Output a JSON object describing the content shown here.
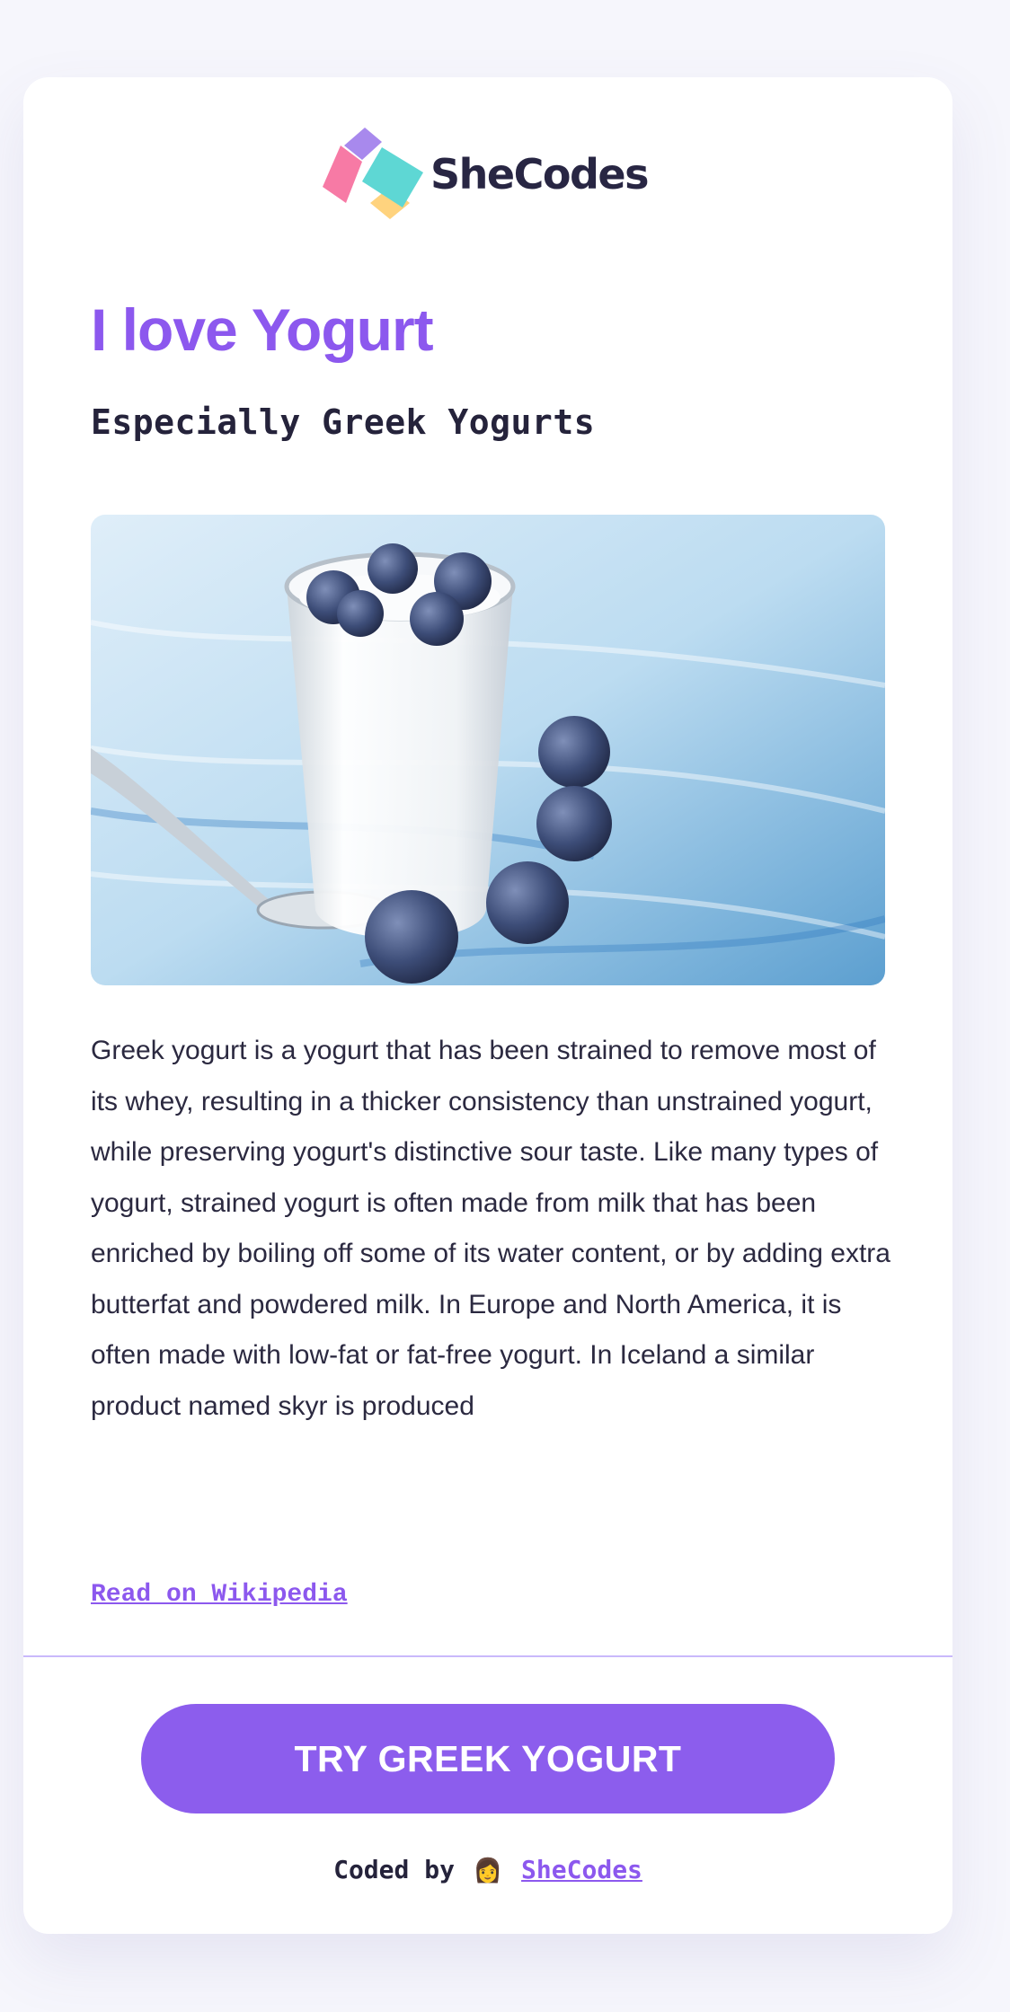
{
  "brand": {
    "name": "SheCodes",
    "colors": {
      "accent": "#8c58ee",
      "button": "#8c5ded",
      "divider": "#c9b9fb",
      "logo_purple": "#a889ed",
      "logo_pink": "#f77aa5",
      "logo_teal": "#5ed7d4",
      "logo_yellow": "#ffd37e"
    }
  },
  "header": {
    "title": "I love Yogurt",
    "subtitle": "Especially Greek Yogurts"
  },
  "image": {
    "subject": "glass-of-yogurt-with-blueberries"
  },
  "description": "Greek yogurt is a yogurt that has been strained to remove most of its whey, resulting in a thicker consistency than unstrained yogurt, while preserving yogurt's distinctive sour taste. Like many types of yogurt, strained yogurt is often made from milk that has been enriched by boiling off some of its water content, or by adding extra butterfat and powdered milk. In Europe and North America, it is often made with low-fat or fat-free yogurt. In Iceland a similar product named skyr is produced",
  "wiki_link": "Read on Wikipedia",
  "cta": {
    "label": "TRY GREEK YOGURT"
  },
  "footer": {
    "prefix": "Coded by",
    "emoji": "👩",
    "link_text": "SheCodes"
  }
}
